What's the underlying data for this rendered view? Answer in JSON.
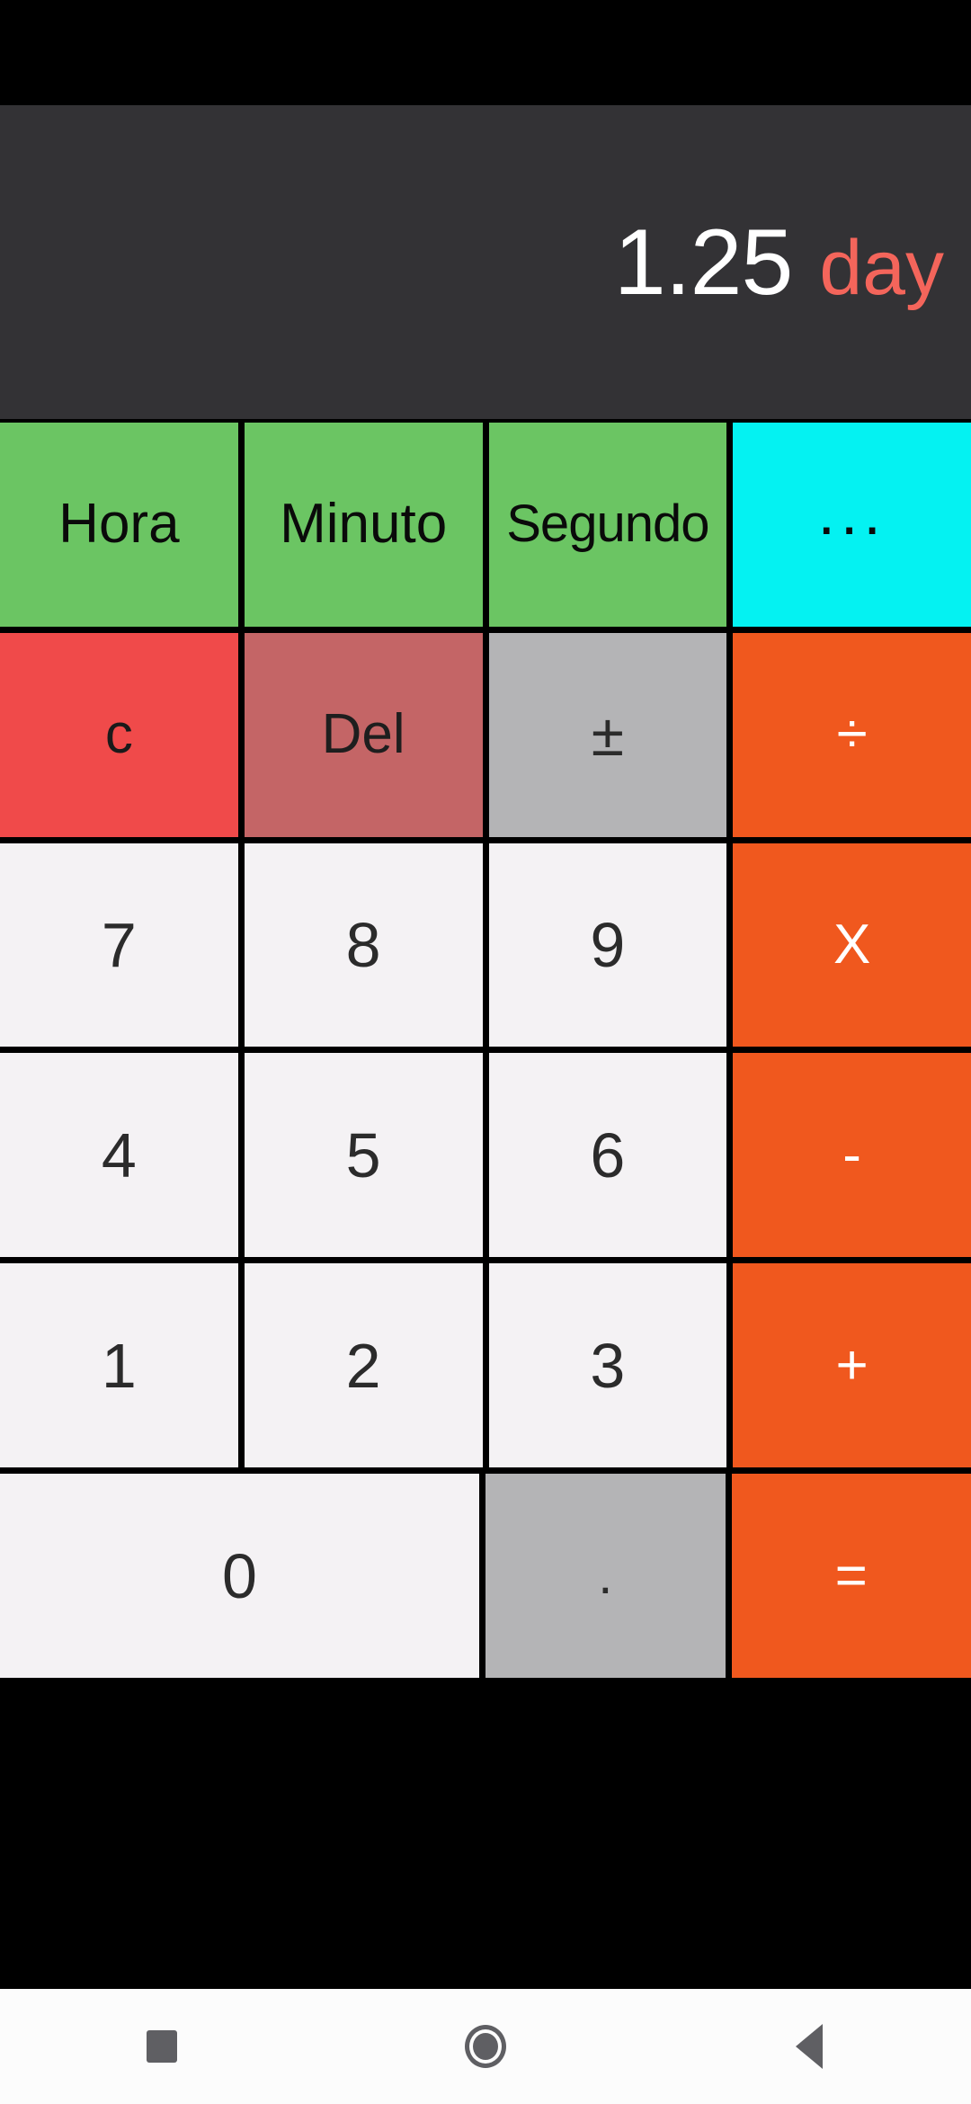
{
  "app": {
    "name": "Unit Calculator",
    "accent_orange": "#F0581E",
    "accent_green": "#6BC563",
    "accent_cyan": "#04F2F2",
    "accent_red": "#F04A4A",
    "display_bg": "#333235",
    "unit_color": "#F4655B"
  },
  "display": {
    "value": "1.25",
    "unit": "day"
  },
  "unit_row": {
    "keys": [
      {
        "label": "Hora",
        "name": "unit-hora"
      },
      {
        "label": "Minuto",
        "name": "unit-minuto"
      },
      {
        "label": "Segundo",
        "name": "unit-segundo"
      },
      {
        "label": "...",
        "name": "more-units"
      }
    ]
  },
  "keypad": {
    "rows": [
      {
        "keys": [
          {
            "label": "c",
            "name": "clear"
          },
          {
            "label": "Del",
            "name": "delete"
          },
          {
            "label": "±",
            "name": "plus-minus"
          },
          {
            "label": "÷",
            "name": "divide"
          }
        ]
      },
      {
        "keys": [
          {
            "label": "7",
            "name": "digit-7"
          },
          {
            "label": "8",
            "name": "digit-8"
          },
          {
            "label": "9",
            "name": "digit-9"
          },
          {
            "label": "X",
            "name": "multiply"
          }
        ]
      },
      {
        "keys": [
          {
            "label": "4",
            "name": "digit-4"
          },
          {
            "label": "5",
            "name": "digit-5"
          },
          {
            "label": "6",
            "name": "digit-6"
          },
          {
            "label": "-",
            "name": "subtract"
          }
        ]
      },
      {
        "keys": [
          {
            "label": "1",
            "name": "digit-1"
          },
          {
            "label": "2",
            "name": "digit-2"
          },
          {
            "label": "3",
            "name": "digit-3"
          },
          {
            "label": "+",
            "name": "add"
          }
        ]
      },
      {
        "keys": [
          {
            "label": "0",
            "name": "digit-0"
          },
          {
            "label": ".",
            "name": "decimal-point"
          },
          {
            "label": "=",
            "name": "equals"
          }
        ]
      }
    ]
  },
  "navbar": {
    "recents_icon": "square-icon",
    "home_icon": "circle-icon",
    "back_icon": "triangle-back-icon"
  }
}
